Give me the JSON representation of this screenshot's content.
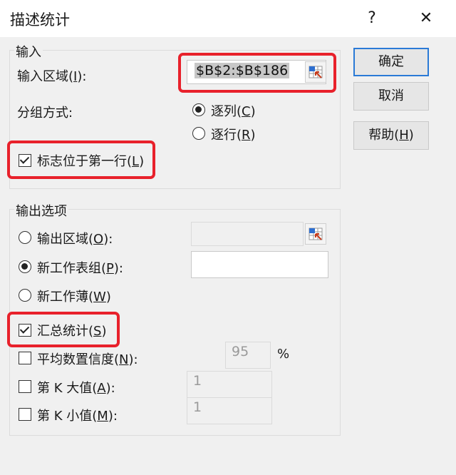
{
  "window": {
    "title": "描述统计",
    "help_glyph": "?",
    "close_glyph": "✕"
  },
  "input_group": {
    "legend": "输入",
    "range_label": "输入区域(",
    "range_key": "I",
    "range_label_end": "):",
    "range_value": "$B$2:$B$186",
    "grouping_label": "分组方式:",
    "by_columns": {
      "text": "逐列(",
      "key": "C",
      "end": ")",
      "selected": true
    },
    "by_rows": {
      "text": "逐行(",
      "key": "R",
      "end": ")",
      "selected": false
    },
    "labels_first_row": {
      "text": "标志位于第一行(",
      "key": "L",
      "end": ")",
      "checked": true
    }
  },
  "output_group": {
    "legend": "输出选项",
    "output_range": {
      "text": "输出区域(",
      "key": "O",
      "end": "):",
      "selected": false,
      "value": ""
    },
    "new_sheet": {
      "text": "新工作表组(",
      "key": "P",
      "end": "):",
      "selected": true,
      "value": ""
    },
    "new_workbook": {
      "text": "新工作薄(",
      "key": "W",
      "end": ")",
      "selected": false
    },
    "summary_stats": {
      "text": "汇总统计(",
      "key": "S",
      "end": ")",
      "checked": true
    },
    "confidence": {
      "text": "平均数置信度(",
      "key": "N",
      "end": "):",
      "checked": false,
      "value": "95",
      "unit": "%"
    },
    "kth_largest": {
      "text": "第 K 大值(",
      "key": "A",
      "end": "):",
      "checked": false,
      "value": "1"
    },
    "kth_smallest": {
      "text": "第 K 小值(",
      "key": "M",
      "end": "):",
      "checked": false,
      "value": "1"
    }
  },
  "buttons": {
    "ok": "确定",
    "cancel": "取消",
    "help": {
      "text": "帮助(",
      "key": "H",
      "end": ")"
    }
  },
  "colors": {
    "highlight": "#e8212b",
    "default_button_border": "#2a7ad6",
    "dialog_bg": "#f0f0f0"
  },
  "icons": {
    "range_picker": "range-picker-icon"
  }
}
